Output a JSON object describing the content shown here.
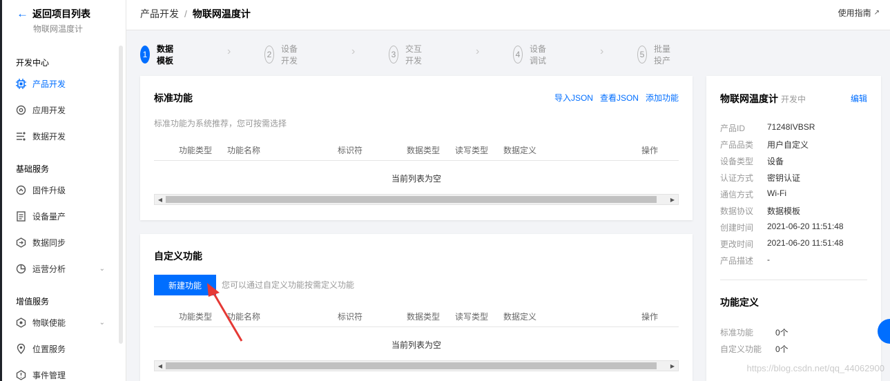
{
  "sidebar": {
    "back_label": "返回项目列表",
    "product_name": "物联网温度计",
    "sections": [
      {
        "title": "开发中心",
        "items": [
          {
            "label": "产品开发",
            "icon": "chip-icon",
            "active": true
          },
          {
            "label": "应用开发",
            "icon": "app-icon"
          },
          {
            "label": "数据开发",
            "icon": "data-flow-icon"
          }
        ]
      },
      {
        "title": "基础服务",
        "items": [
          {
            "label": "固件升级",
            "icon": "firmware-icon"
          },
          {
            "label": "设备量产",
            "icon": "document-icon"
          },
          {
            "label": "数据同步",
            "icon": "sync-icon"
          },
          {
            "label": "运营分析",
            "icon": "analytics-icon",
            "expandable": true
          }
        ]
      },
      {
        "title": "增值服务",
        "items": [
          {
            "label": "物联使能",
            "icon": "enable-icon",
            "expandable": true
          },
          {
            "label": "位置服务",
            "icon": "location-icon"
          },
          {
            "label": "事件管理",
            "icon": "event-icon"
          }
        ]
      }
    ]
  },
  "header": {
    "crumb1": "产品开发",
    "sep": "/",
    "crumb2": "物联网温度计",
    "guide": "使用指南"
  },
  "steps": [
    {
      "num": "1",
      "label": "数据模板"
    },
    {
      "num": "2",
      "label": "设备开发"
    },
    {
      "num": "3",
      "label": "交互开发"
    },
    {
      "num": "4",
      "label": "设备调试"
    },
    {
      "num": "5",
      "label": "批量投产"
    }
  ],
  "standard": {
    "title": "标准功能",
    "links": {
      "import": "导入JSON",
      "view": "查看JSON",
      "add": "添加功能"
    },
    "hint": "标准功能为系统推荐，您可按需选择",
    "empty": "当前列表为空"
  },
  "custom": {
    "title": "自定义功能",
    "new_button": "新建功能",
    "hint": "您可以通过自定义功能按需定义功能",
    "empty": "当前列表为空"
  },
  "table_headers": {
    "type": "功能类型",
    "name": "功能名称",
    "id": "标识符",
    "data_type": "数据类型",
    "rw": "读写类型",
    "def": "数据定义",
    "op": "操作"
  },
  "info": {
    "name": "物联网温度计",
    "status": "开发中",
    "edit": "编辑",
    "fields": [
      {
        "k": "产品ID",
        "v": "71248IVBSR"
      },
      {
        "k": "产品品类",
        "v": "用户自定义"
      },
      {
        "k": "设备类型",
        "v": "设备"
      },
      {
        "k": "认证方式",
        "v": "密钥认证"
      },
      {
        "k": "通信方式",
        "v": "Wi-Fi"
      },
      {
        "k": "数据协议",
        "v": "数据模板"
      },
      {
        "k": "创建时间",
        "v": "2021-06-20 11:51:48"
      },
      {
        "k": "更改时间",
        "v": "2021-06-20 11:51:48"
      },
      {
        "k": "产品描述",
        "v": "-"
      }
    ],
    "func_title": "功能定义",
    "func_fields": [
      {
        "k": "标准功能",
        "v": "0个"
      },
      {
        "k": "自定义功能",
        "v": "0个"
      }
    ]
  },
  "watermark": "https://blog.csdn.net/qq_44062900",
  "colors": {
    "primary": "#006eff",
    "annotation": "#e53935"
  }
}
